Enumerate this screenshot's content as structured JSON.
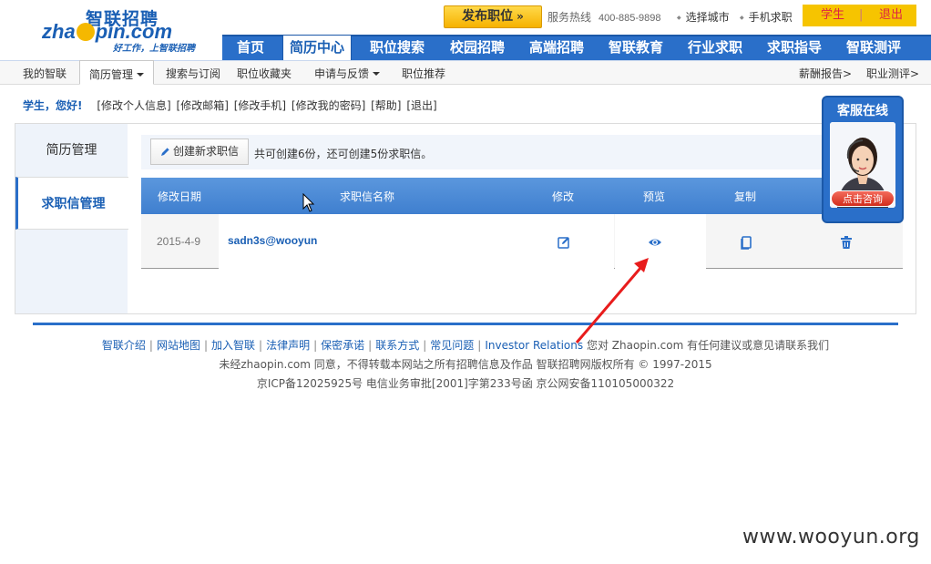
{
  "header": {
    "brand_cn": "智联招聘",
    "brand_en_pre": "zha",
    "brand_en_post": "pin.com",
    "slogan": "好工作，上智联招聘",
    "post_job": "发布职位",
    "hotline_label": "服务热线",
    "hotline_num": "400-885-9898",
    "select_city": "选择城市",
    "mobile": "手机求职",
    "user": "学生",
    "separator": "|",
    "logout": "退出"
  },
  "mainnav": [
    "首页",
    "简历中心",
    "职位搜索",
    "校园招聘",
    "高端招聘",
    "智联教育",
    "行业求职",
    "求职指导",
    "智联测评"
  ],
  "subnav": {
    "items": [
      "我的智联",
      "简历管理",
      "搜索与订阅",
      "职位收藏夹",
      "申请与反馈",
      "职位推荐"
    ],
    "right": [
      "薪酬报告>",
      "职业测评>"
    ]
  },
  "greeting": {
    "hello": "学生，您好!",
    "links": [
      "[修改个人信息]",
      "[修改邮箱]",
      "[修改手机]",
      "[修改我的密码]",
      "[帮助]",
      "[退出]"
    ]
  },
  "sidebar": [
    "简历管理",
    "求职信管理"
  ],
  "toolbar": {
    "create": "创建新求职信",
    "note": "共可创建6份，还可创建5份求职信。"
  },
  "table": {
    "headers": [
      "修改日期",
      "求职信名称",
      "修改",
      "预览",
      "复制"
    ],
    "rows": [
      {
        "date": "2015-4-9",
        "name": "sadn3s@wooyun"
      }
    ]
  },
  "kefu": {
    "title": "客服在线",
    "button": "点击咨询"
  },
  "footer": {
    "links": [
      "智联介绍",
      "网站地图",
      "加入智联",
      "法律声明",
      "保密承诺",
      "联系方式",
      "常见问题",
      "Investor Relations"
    ],
    "links_tail": "您对 Zhaopin.com 有任何建议或意见请联系我们",
    "copyright": "未经zhaopin.com 同意，不得转载本网站之所有招聘信息及作品 智联招聘网版权所有 © 1997-2015",
    "icp": "京ICP备12025925号 电信业务审批[2001]字第233号函 京公网安备110105000322"
  },
  "watermark": "www.wooyun.org",
  "colors": {
    "primary": "#2a6fc9",
    "accent": "#f6c400",
    "arrow": "#e81c1c"
  }
}
